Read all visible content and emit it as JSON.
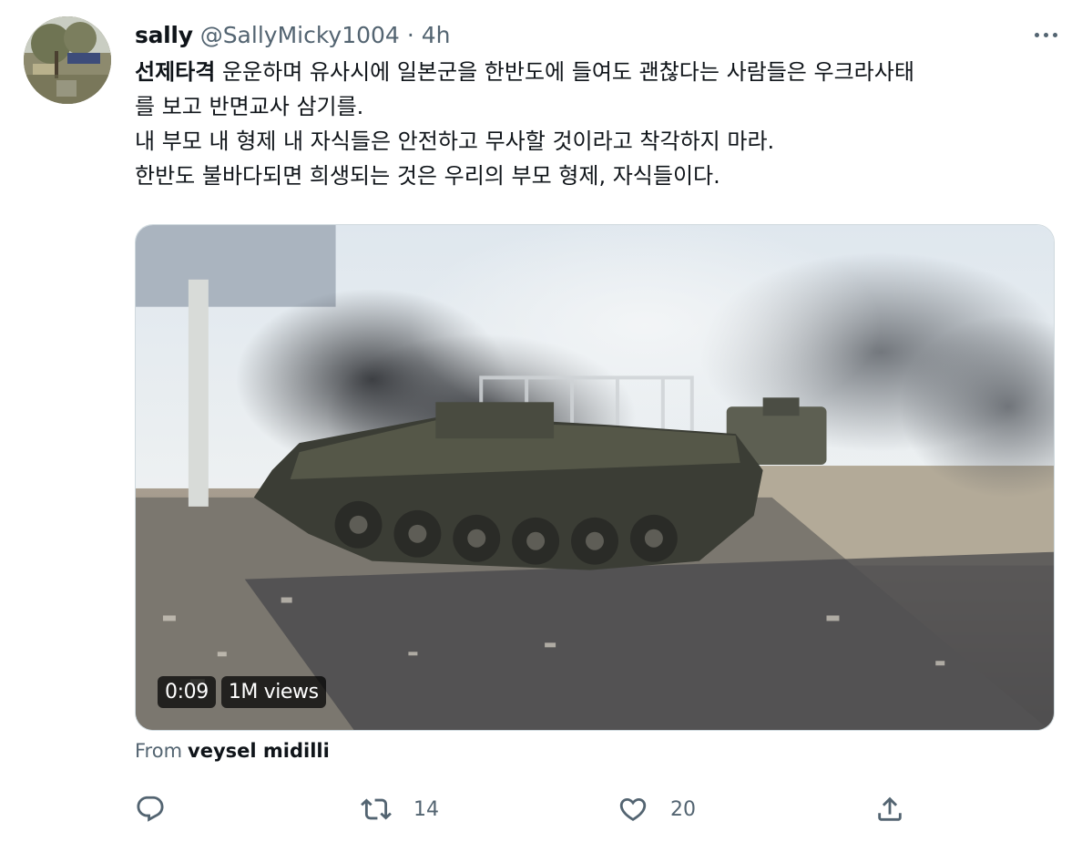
{
  "tweet": {
    "display_name": "sally",
    "handle": "@SallyMicky1004",
    "separator": "·",
    "time": "4h",
    "body": {
      "hashtag": "선제타격",
      "line1_rest": " 운운하며 유사시에 일본군을 한반도에 들여도 괜찮다는 사람들은 우크라사태",
      "line2": "를 보고 반면교사 삼기를.",
      "line3": "내 부모 내 형제 내 자식들은 안전하고 무사할 것이라고 착각하지 마라.",
      "line4": "한반도 불바다되면 희생되는 것은 우리의 부모 형제, 자식들이다."
    },
    "video": {
      "duration": "0:09",
      "views": "1M views"
    },
    "from_label": "From",
    "from_source": "veysel midilli",
    "actions": {
      "reply_icon": "reply-icon",
      "retweet_icon": "retweet-icon",
      "retweet_count": "14",
      "like_icon": "heart-icon",
      "like_count": "20",
      "share_icon": "share-icon"
    }
  },
  "colors": {
    "text_primary": "#0f1419",
    "text_secondary": "#536471",
    "border": "#cfd9de"
  }
}
